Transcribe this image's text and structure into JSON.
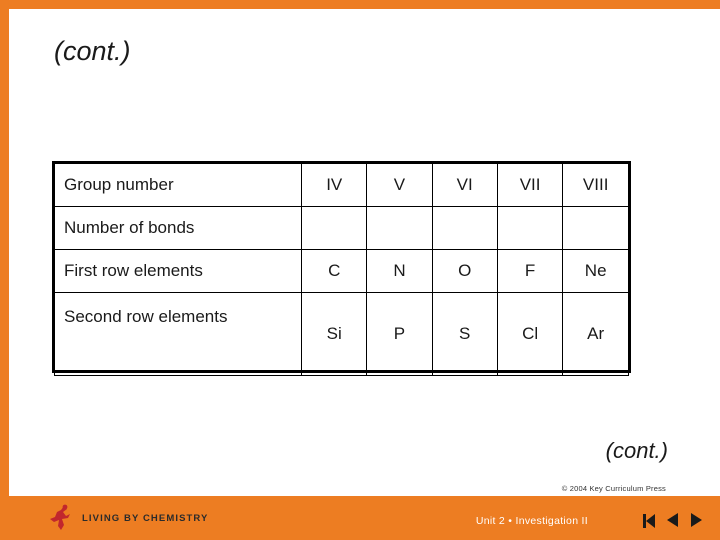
{
  "slide": {
    "title": "(cont.)",
    "continued_label": "(cont.)",
    "copyright": "© 2004 Key Curriculum Press",
    "footer": "Unit 2 •  Investigation II",
    "logo_text": "LIVING BY CHEMISTRY",
    "accent_color": "#ED7D22"
  },
  "table": {
    "rows": [
      {
        "label": "Group number",
        "cells": [
          "IV",
          "V",
          "VI",
          "VII",
          "VIII"
        ]
      },
      {
        "label": "Number of bonds",
        "cells": [
          "",
          "",
          "",
          "",
          ""
        ]
      },
      {
        "label": "First row elements",
        "cells": [
          "C",
          "N",
          "O",
          "F",
          "Ne"
        ]
      },
      {
        "label": "Second row elements",
        "cells": [
          "Si",
          "P",
          "S",
          "Cl",
          "Ar"
        ]
      }
    ]
  },
  "nav": {
    "first_label": "first-slide",
    "prev_label": "previous-slide",
    "next_label": "next-slide"
  }
}
